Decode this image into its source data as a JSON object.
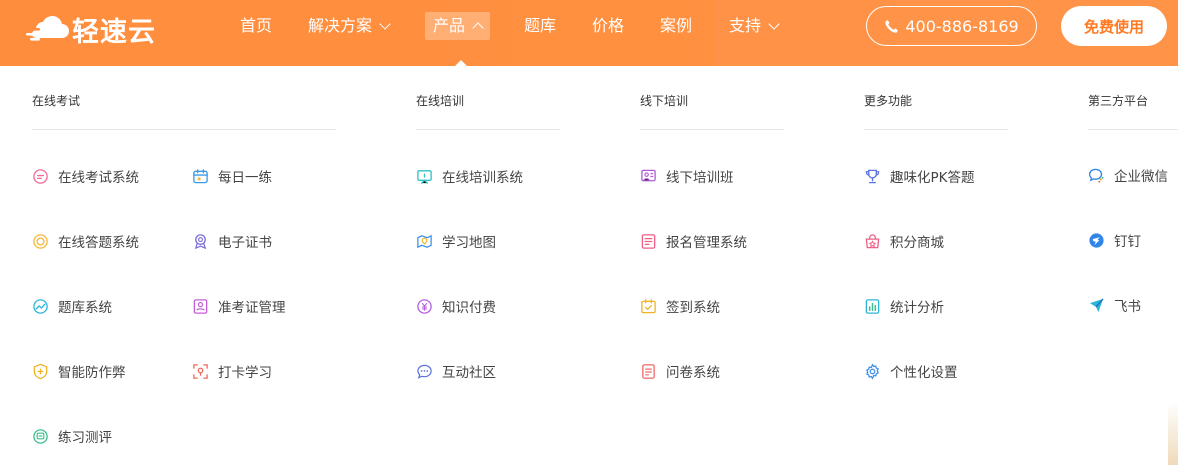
{
  "brand": {
    "name": "轻速云"
  },
  "nav": {
    "home": "首页",
    "solutions": "解决方案",
    "products": "产品",
    "question_bank": "题库",
    "pricing": "价格",
    "cases": "案例",
    "support": "支持"
  },
  "header": {
    "phone": "400-886-8169",
    "free_trial": "免费使用"
  },
  "menu": {
    "exam": {
      "title": "在线考试",
      "items": [
        "在线考试系统",
        "每日一练",
        "在线答题系统",
        "电子证书",
        "题库系统",
        "准考证管理",
        "智能防作弊",
        "打卡学习",
        "练习测评"
      ]
    },
    "training": {
      "title": "在线培训",
      "items": [
        "在线培训系统",
        "学习地图",
        "知识付费",
        "互动社区"
      ]
    },
    "offline": {
      "title": "线下培训",
      "items": [
        "线下培训班",
        "报名管理系统",
        "签到系统",
        "问卷系统"
      ]
    },
    "more": {
      "title": "更多功能",
      "items": [
        "趣味化PK答题",
        "积分商城",
        "统计分析",
        "个性化设置"
      ]
    },
    "third_party": {
      "title": "第三方平台",
      "items": [
        "企业微信",
        "钉钉",
        "飞书"
      ]
    }
  },
  "colors": {
    "header_orange": "#ff8d3e",
    "accent": "#ff7a22"
  },
  "icons": {
    "exam": [
      "exam-system-icon",
      "daily-practice-icon",
      "answer-system-icon",
      "certificate-icon",
      "question-bank-icon",
      "admission-ticket-icon",
      "anti-cheat-icon",
      "checkin-learning-icon",
      "practice-eval-icon"
    ],
    "training": [
      "training-system-icon",
      "learning-map-icon",
      "paid-knowledge-icon",
      "community-icon"
    ],
    "offline": [
      "offline-class-icon",
      "registration-icon",
      "signin-icon",
      "survey-icon"
    ],
    "more": [
      "pk-trophy-icon",
      "points-mall-icon",
      "statistics-icon",
      "settings-gear-icon"
    ],
    "third_party": [
      "wecom-icon",
      "dingtalk-icon",
      "feishu-icon"
    ]
  }
}
